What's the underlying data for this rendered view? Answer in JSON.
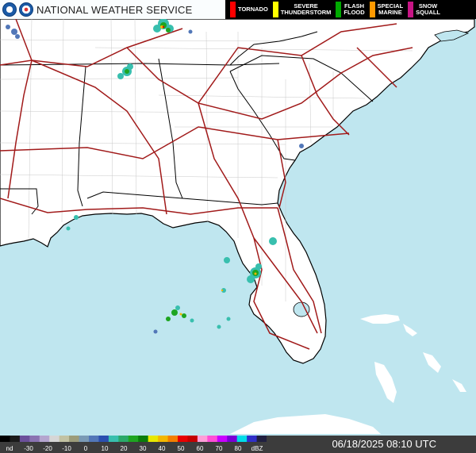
{
  "header": {
    "title": "NATIONAL WEATHER SERVICE",
    "legend": [
      {
        "label": "TORNADO",
        "color": "#ff0000"
      },
      {
        "label": "SEVERE\nTHUNDERSTORM",
        "color": "#ffff00"
      },
      {
        "label": "FLASH\nFLOOD",
        "color": "#00aa00"
      },
      {
        "label": "SPECIAL\nMARINE",
        "color": "#ff9900"
      },
      {
        "label": "SNOW\nSQUALL",
        "color": "#c71585"
      }
    ]
  },
  "scale": {
    "labels": [
      "nd",
      "-30",
      "-20",
      "-10",
      "0",
      "10",
      "20",
      "30",
      "40",
      "50",
      "60",
      "70",
      "80",
      "dBZ"
    ],
    "colors": [
      "#000000",
      "#1a1a1a",
      "#6b4f9b",
      "#8a73b2",
      "#b4a5cf",
      "#d6d6d6",
      "#c2c2a3",
      "#9c9c7a",
      "#7a9ab5",
      "#5277b8",
      "#2a4fb0",
      "#38bfae",
      "#2aa96a",
      "#1ea521",
      "#0b7d0b",
      "#e8e800",
      "#f2b700",
      "#f37e00",
      "#e80000",
      "#c40000",
      "#ff9ed8",
      "#ff4fd6",
      "#c800ff",
      "#7a00d6",
      "#00dce8",
      "#3030c8",
      "#202040"
    ]
  },
  "footer": {
    "timestamp": "06/18/2025 08:10 UTC"
  }
}
